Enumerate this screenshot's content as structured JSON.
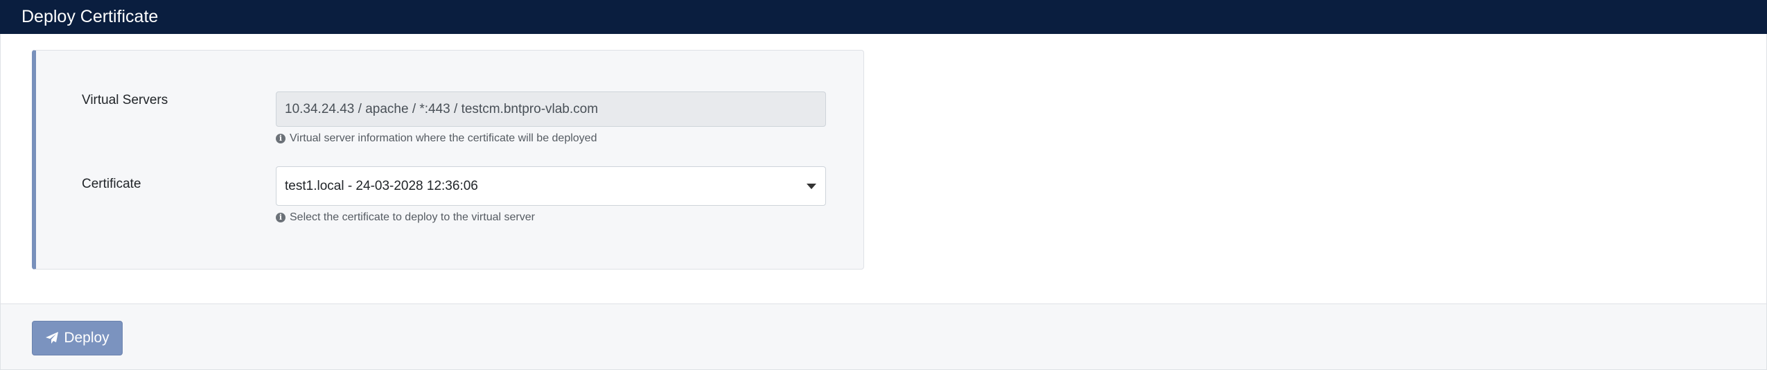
{
  "header": {
    "title": "Deploy Certificate"
  },
  "form": {
    "virtual_servers": {
      "label": "Virtual Servers",
      "value": "10.34.24.43 / apache / *:443 / testcm.bntpro-vlab.com",
      "help": "Virtual server information where the certificate will be deployed"
    },
    "certificate": {
      "label": "Certificate",
      "selected": "test1.local - 24-03-2028 12:36:06",
      "help": "Select the certificate to deploy to the virtual server"
    }
  },
  "footer": {
    "deploy_label": "Deploy"
  },
  "icons": {
    "info": "info-circle-icon",
    "deploy": "paper-plane-icon",
    "dropdown": "caret-down-icon"
  },
  "colors": {
    "header_bg": "#0a1e3f",
    "accent": "#7890bb",
    "button_bg": "#7b93bf"
  }
}
